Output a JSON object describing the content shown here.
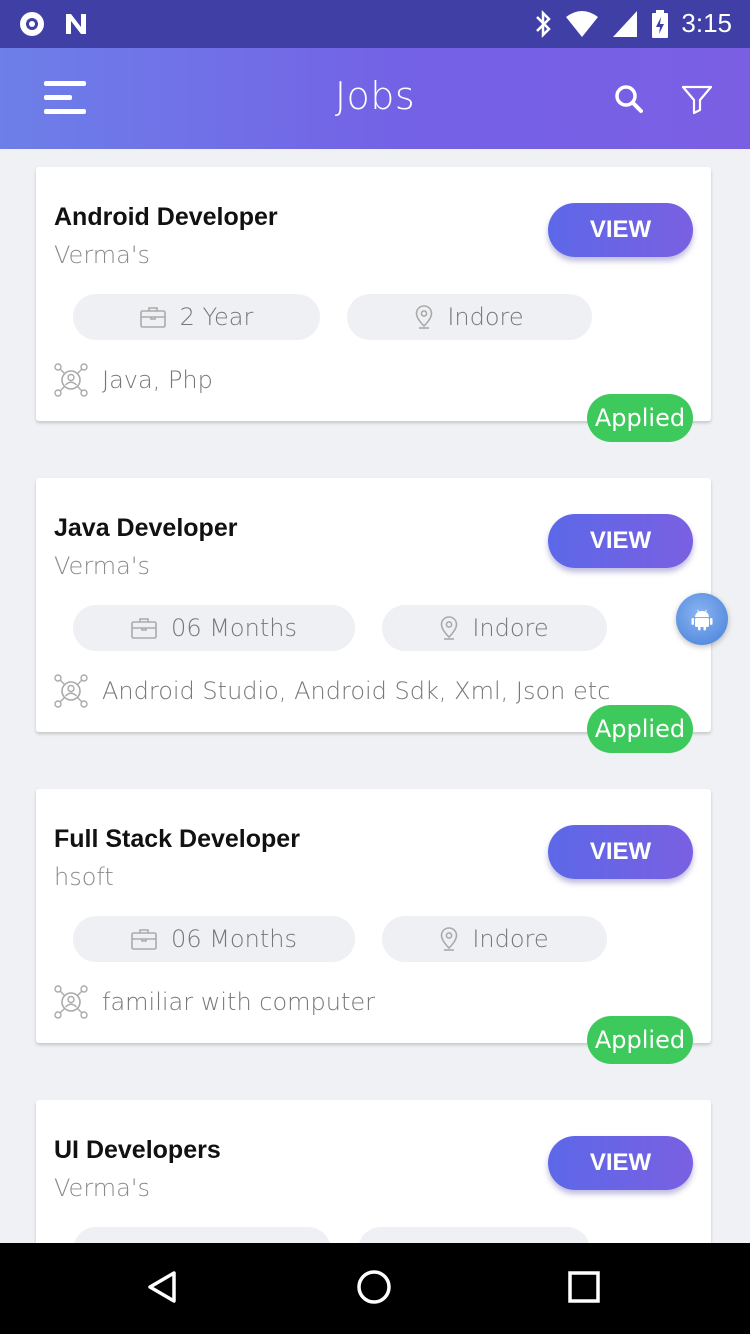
{
  "status_bar": {
    "time": "3:15",
    "icons": [
      "app-circle-icon",
      "n-logo-icon",
      "bluetooth-icon",
      "wifi-icon",
      "signal-icon",
      "battery-icon"
    ]
  },
  "app_bar": {
    "title": "Jobs",
    "icons": [
      "menu-icon",
      "search-icon",
      "filter-icon"
    ]
  },
  "colors": {
    "status_bar": "#3f3fa6",
    "app_bar_start": "#6d7fe8",
    "app_bar_end": "#7b5fe3",
    "view_button": "#6564e6",
    "applied_badge": "#3ec95c",
    "background": "#f0f1f4"
  },
  "jobs": [
    {
      "title": "Android Developer",
      "company": "Verma's",
      "experience": "2 Year",
      "location": "Indore",
      "skills": "Java, Php",
      "view_label": "VIEW",
      "status": "Applied"
    },
    {
      "title": "Java Developer",
      "company": "Verma's",
      "experience": "06 Months",
      "location": "Indore",
      "skills": "Android Studio, Android Sdk, Xml, Json etc",
      "view_label": "VIEW",
      "status": "Applied"
    },
    {
      "title": "Full Stack Developer",
      "company": "hsoft",
      "experience": "06 Months",
      "location": "Indore",
      "skills": "familiar with computer",
      "view_label": "VIEW",
      "status": "Applied"
    },
    {
      "title": "UI Developers",
      "company": "Verma's",
      "view_label": "VIEW"
    }
  ],
  "nav_bar": {
    "icons": [
      "back-icon",
      "home-icon",
      "recents-icon"
    ]
  }
}
